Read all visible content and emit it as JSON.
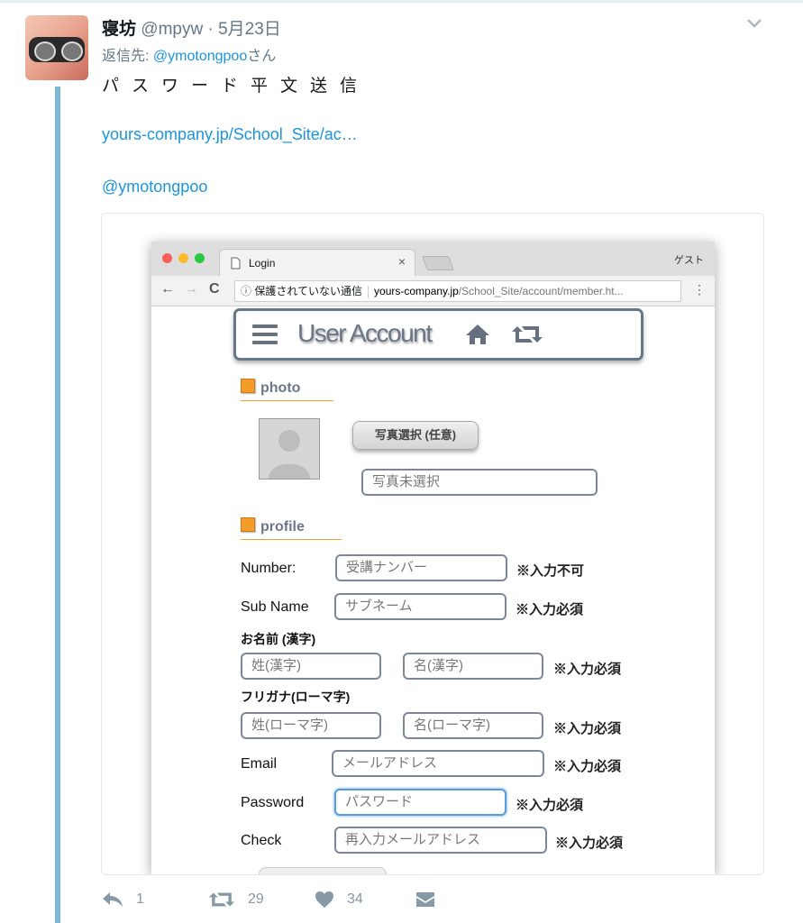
{
  "tweet": {
    "display_name": "寝坊",
    "handle": "@mpyw",
    "date": " · 5月23日",
    "reply_prefix": "返信先: ",
    "reply_to": "@ymotongpoo",
    "reply_suffix": "さん",
    "text": "パスワード平文送信",
    "link": "yours-company.jp/School_Site/ac…",
    "mention": "@ymotongpoo",
    "counts": {
      "reply": "1",
      "retweet": "29",
      "like": "34"
    }
  },
  "browser": {
    "tab_title": "Login",
    "tab_close": "×",
    "profile": "ゲスト",
    "back": "←",
    "forward": "→",
    "reload": "C",
    "security_text": "保護されていない通信",
    "url_domain": "yours-company.jp",
    "url_path": "/School_Site/account/member.ht...",
    "menu": "⋮"
  },
  "page": {
    "title": "User Account",
    "photo_section": "photo",
    "photo_button": "写真選択 (任意)",
    "photo_status_placeholder": "写真未選択",
    "profile_section": "profile",
    "fields": {
      "number": {
        "label": "Number:",
        "placeholder": "受講ナンバー",
        "note": "※入力不可"
      },
      "subname": {
        "label": "Sub Name",
        "placeholder": "サブネーム",
        "note": "※入力必須"
      },
      "kanji_label": "お名前 (漢字)",
      "last_kanji": {
        "placeholder": "姓(漢字)"
      },
      "first_kanji": {
        "placeholder": "名(漢字)"
      },
      "kanji_note": "※入力必須",
      "roman_label": "フリガナ(ローマ字)",
      "last_roman": {
        "placeholder": "姓(ローマ字)"
      },
      "first_roman": {
        "placeholder": "名(ローマ字)"
      },
      "roman_note": "※入力必須",
      "email": {
        "label": "Email",
        "placeholder": "メールアドレス",
        "note": "※入力必須"
      },
      "password": {
        "label": "Password",
        "placeholder": "パスワード",
        "note": "※入力必須"
      },
      "check": {
        "label": "Check",
        "placeholder": "再入力メールアドレス",
        "note": "※入力必須"
      }
    }
  },
  "colors": {
    "accent": "#1b95e0",
    "thread": "#7ab8d6",
    "section": "#f39c28"
  },
  "icons": [
    "chevron-down-icon",
    "page-icon",
    "info-icon",
    "hamburger-icon",
    "home-icon",
    "retweet-icon",
    "reply-icon",
    "like-icon",
    "dm-icon"
  ]
}
